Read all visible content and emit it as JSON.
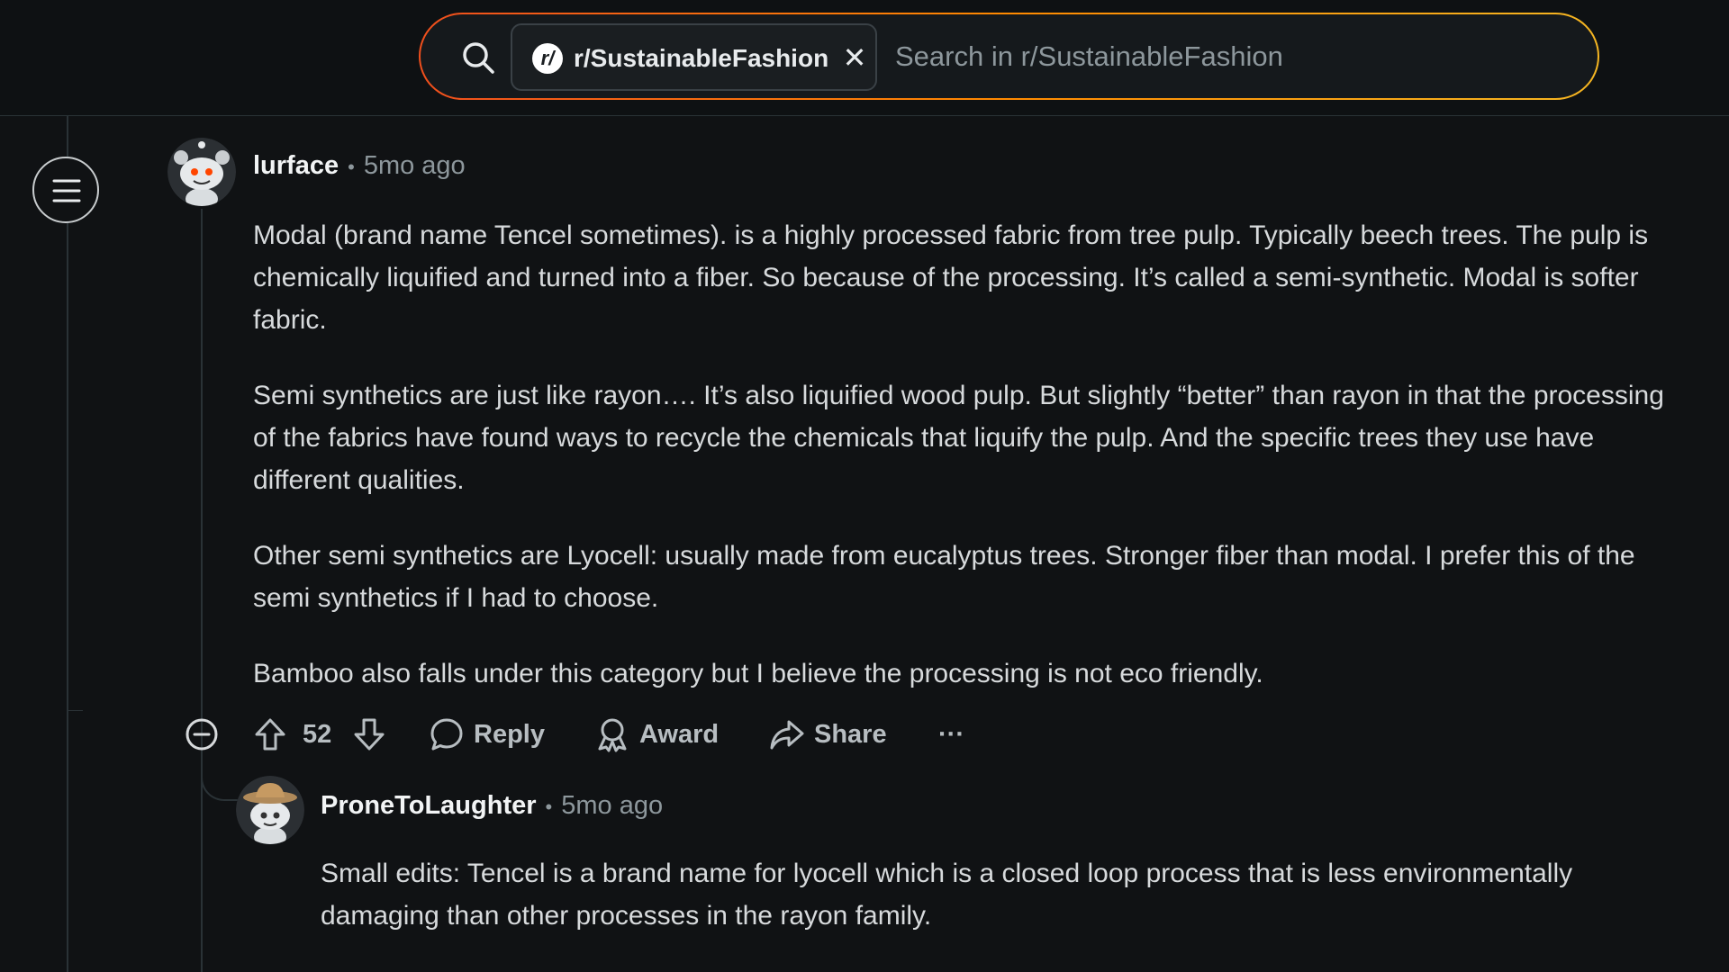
{
  "search": {
    "community": "r/SustainableFashion",
    "placeholder": "Search in r/SustainableFashion",
    "accent_colors": [
      "#f04f1d",
      "#ff8a00",
      "#f5b622"
    ]
  },
  "comments": [
    {
      "username": "lurface",
      "time": "5mo ago",
      "paragraphs": [
        "Modal (brand name Tencel sometimes). is a highly processed fabric from tree pulp. Typically beech trees. The pulp is chemically liquified and turned into a fiber. So because of the processing. It’s called a semi-synthetic. Modal is softer fabric.",
        "Semi synthetics are just like rayon…. It’s also liquified wood pulp. But slightly “better” than rayon in that the processing of the fabrics have found ways to recycle the chemicals that liquify the pulp. And the specific trees they use have different qualities.",
        "Other semi synthetics are Lyocell: usually made from eucalyptus trees. Stronger fiber than modal. I prefer this of the semi synthetics if I had to choose.",
        "Bamboo also falls under this category but I believe the processing is not eco friendly."
      ],
      "score": "52",
      "actions": {
        "reply": "Reply",
        "award": "Award",
        "share": "Share",
        "more": "···"
      }
    },
    {
      "username": "ProneToLaughter",
      "time": "5mo ago",
      "paragraphs": [
        "Small edits: Tencel is a brand name for lyocell which is a closed loop process that is less environmentally damaging than other processes in the rayon family."
      ]
    }
  ],
  "icons": {
    "search": "search-icon",
    "close": "close-icon",
    "menu": "hamburger-menu-icon",
    "collapse": "collapse-thread-icon",
    "upvote": "upvote-arrow-icon",
    "downvote": "downvote-arrow-icon",
    "reply": "comment-bubble-icon",
    "award": "award-ribbon-icon",
    "share": "share-arrow-icon"
  }
}
